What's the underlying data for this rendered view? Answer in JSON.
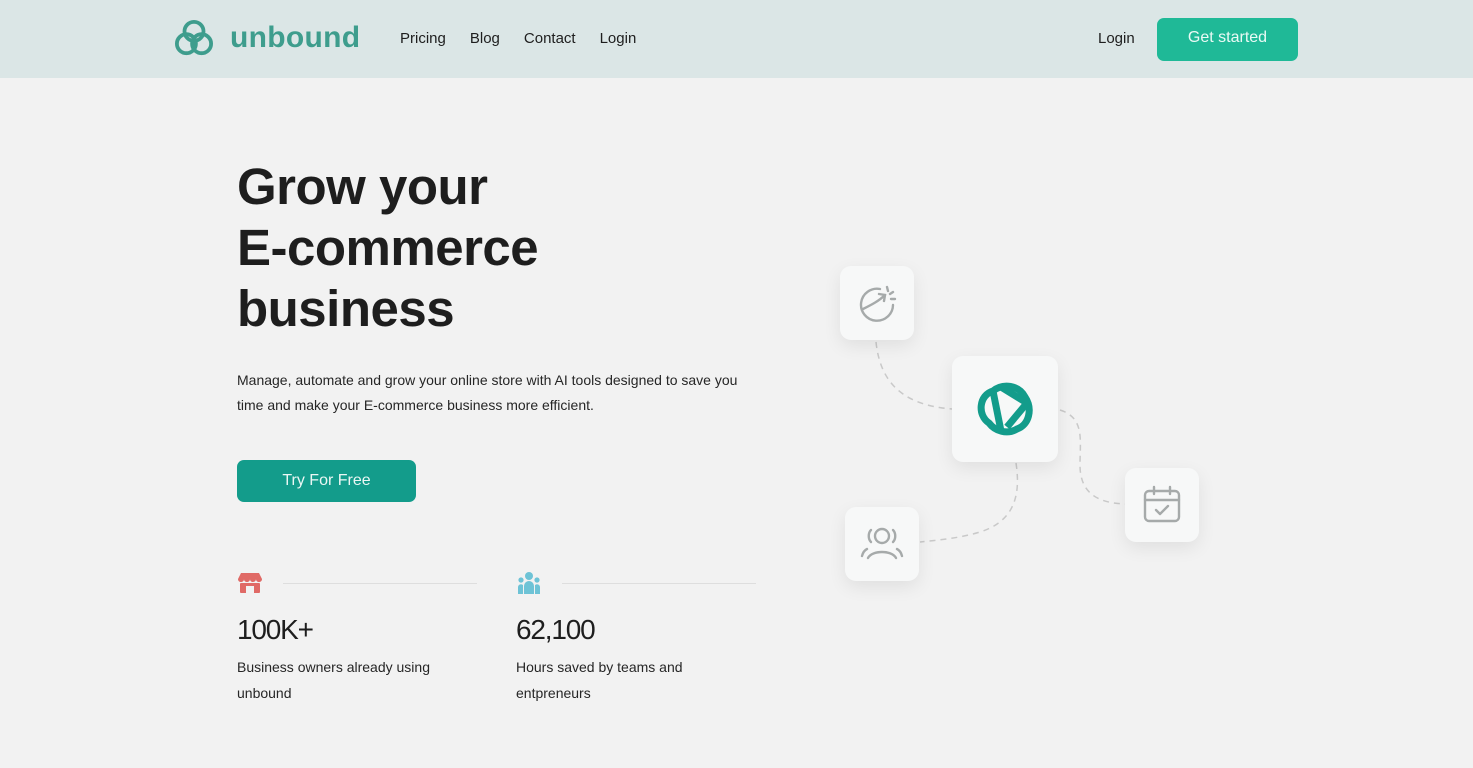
{
  "nav": {
    "brand": "unbound",
    "links": [
      "Pricing",
      "Blog",
      "Contact",
      "Login"
    ],
    "login_label": "Login",
    "cta_label": "Get started"
  },
  "hero": {
    "title_lines": [
      "Grow your",
      "E-commerce",
      "business"
    ],
    "subtitle": "Manage, automate and grow your online store with AI tools designed to save you time and make your E-commerce business more efficient.",
    "cta_label": "Try For Free"
  },
  "stats": [
    {
      "icon": "store-icon",
      "value": "100K+",
      "label": "Business owners already using unbound"
    },
    {
      "icon": "team-icon",
      "value": "62,100",
      "label": "Hours saved by teams and entpreneurs"
    }
  ],
  "colors": {
    "brand": "#3e9d8d",
    "cta_primary": "#1fb997",
    "cta_secondary": "#139c8b",
    "store_icon": "#e06a66",
    "team_icon": "#6ec3d6"
  }
}
